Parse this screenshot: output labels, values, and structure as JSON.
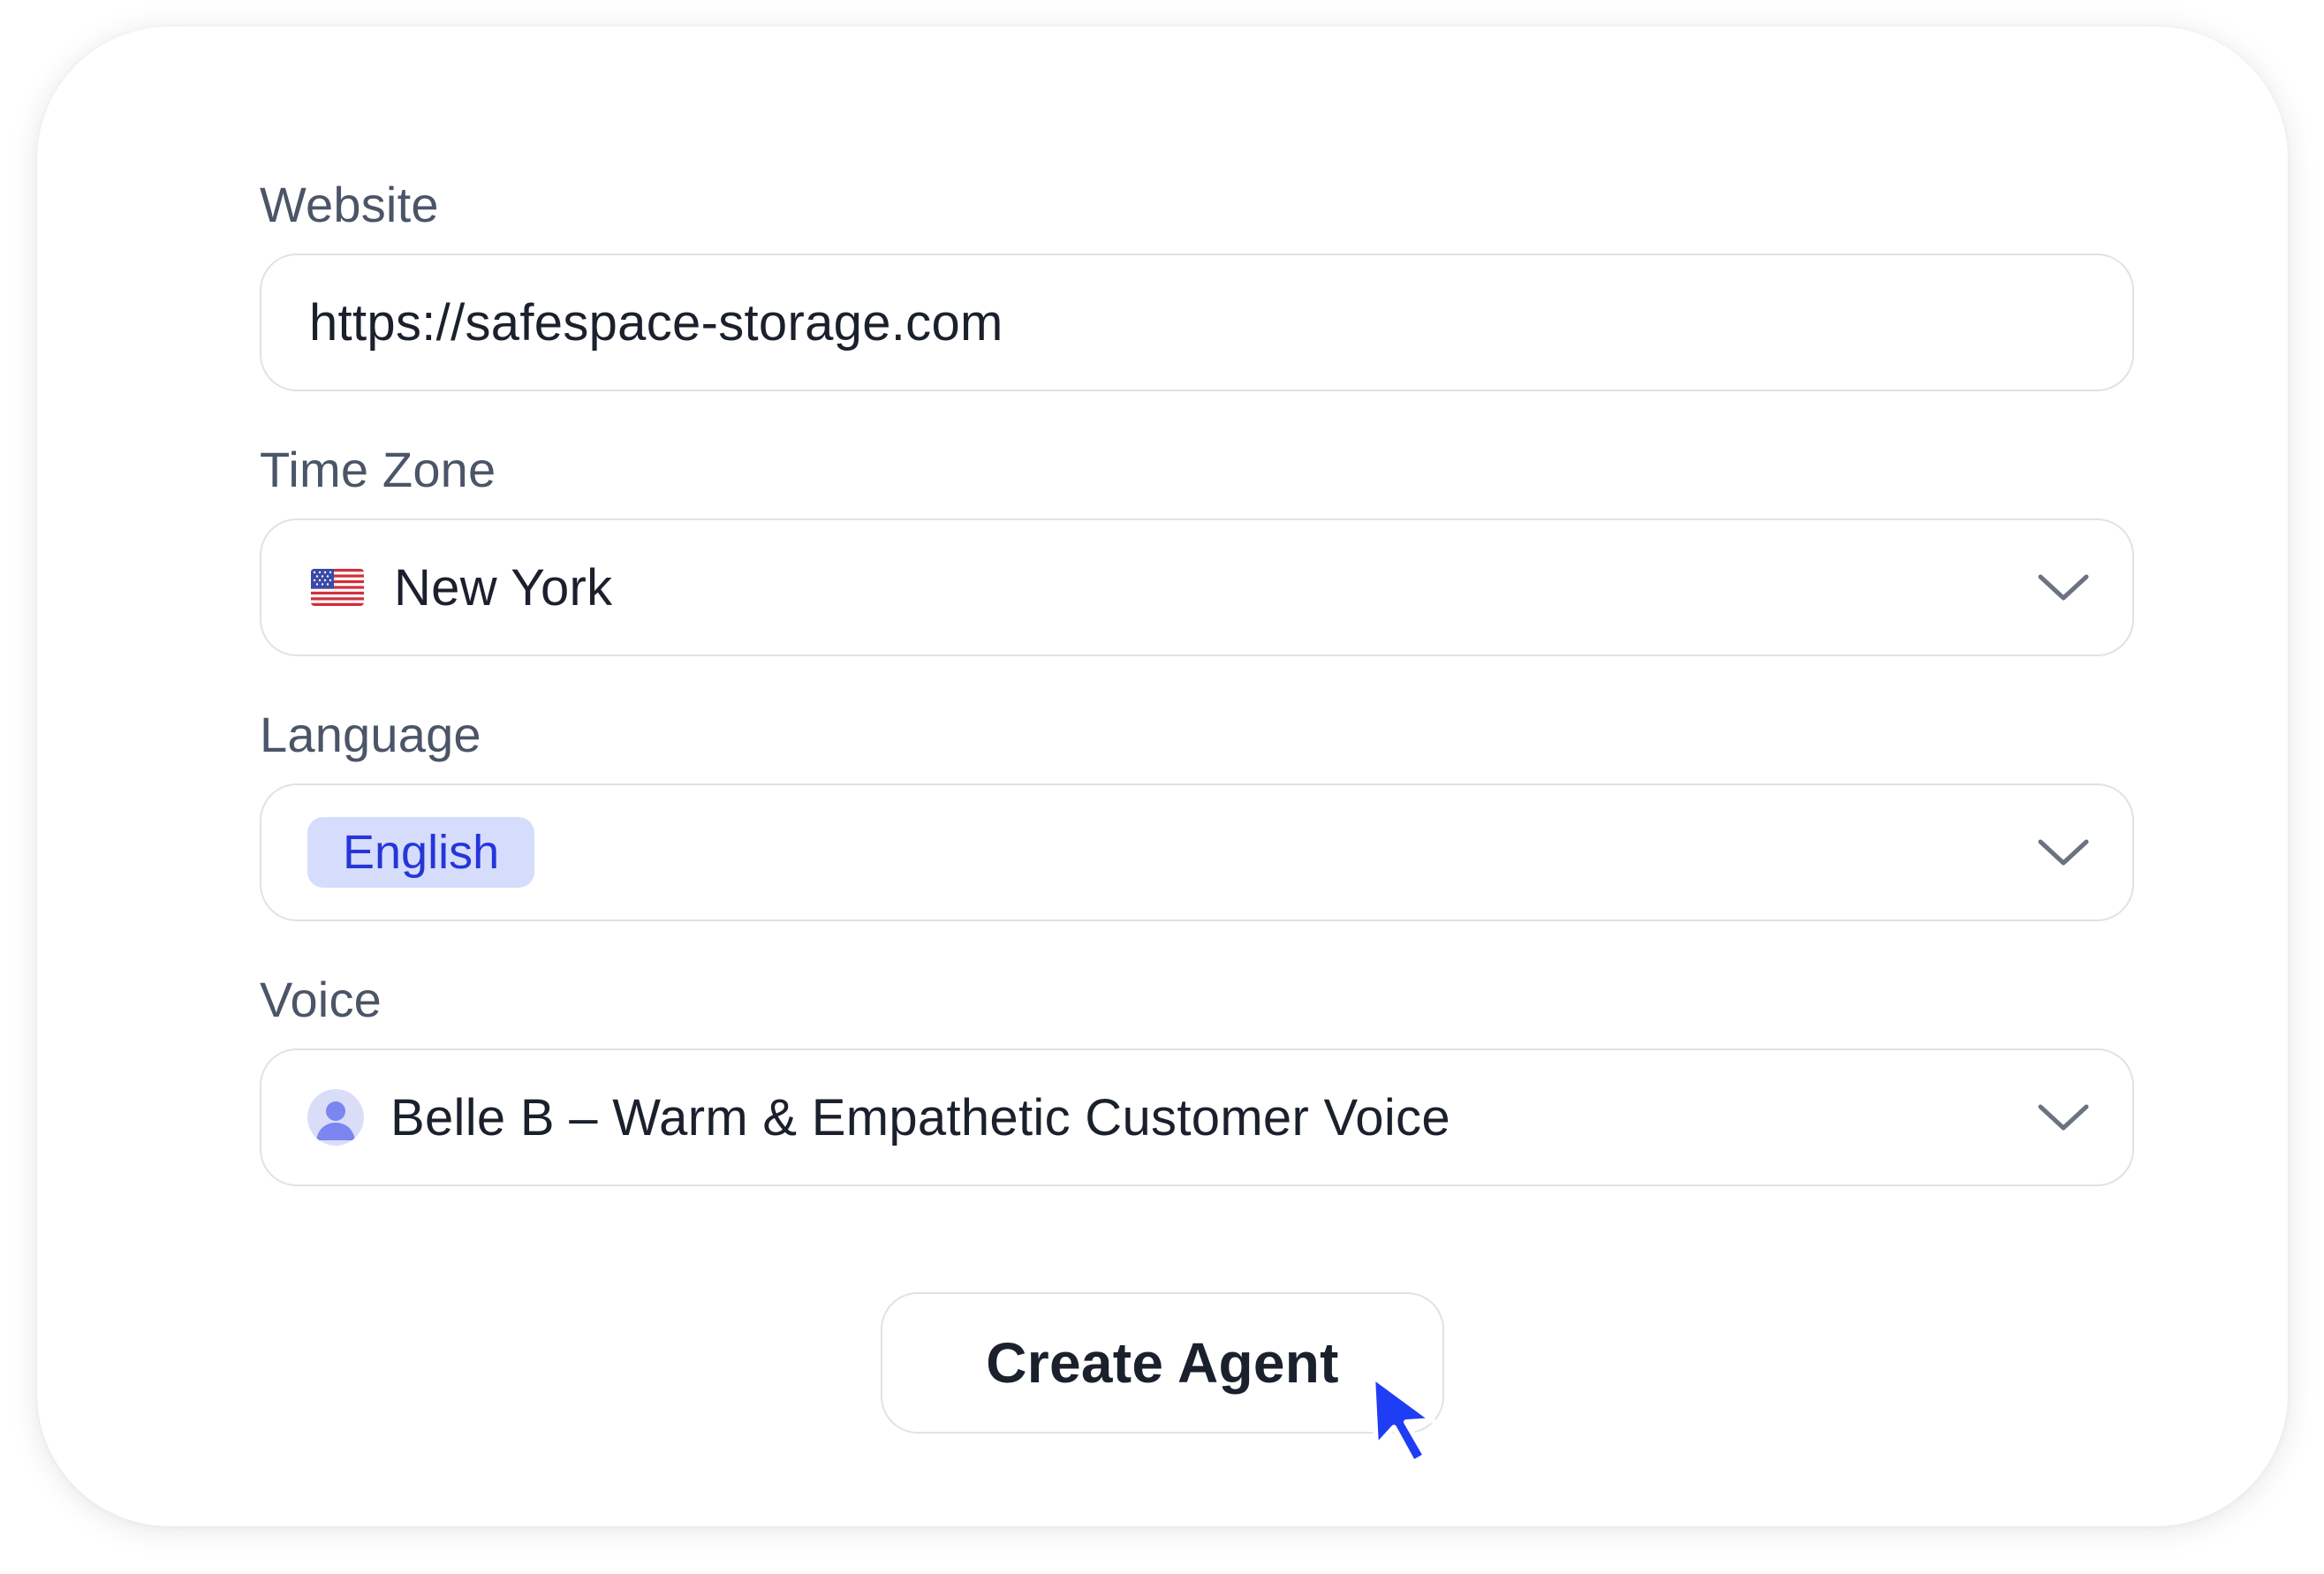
{
  "form": {
    "website": {
      "label": "Website",
      "value": "https://safespace-storage.com"
    },
    "timezone": {
      "label": "Time Zone",
      "value": "New York",
      "flag_icon": "us-flag-icon"
    },
    "language": {
      "label": "Language",
      "selected_chip": "English",
      "chip_bg": "#d6dcfb",
      "chip_color": "#2536d8"
    },
    "voice": {
      "label": "Voice",
      "value": "Belle B – Warm & Empathetic Customer Voice",
      "avatar_icon": "person-avatar-icon"
    },
    "submit_label": "Create Agent"
  },
  "colors": {
    "accent": "#1f3df5",
    "border": "#dfe2e8",
    "label": "#4b5568",
    "text": "#1a202c"
  }
}
